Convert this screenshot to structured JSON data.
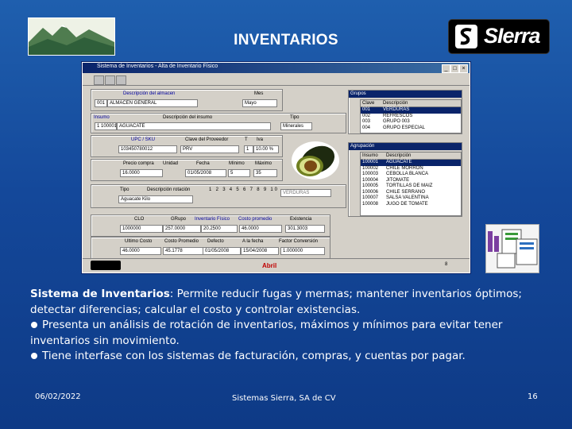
{
  "slide": {
    "title": "INVENTARIOS",
    "logo_text": "SIerra",
    "date": "06/02/2022",
    "company": "Sistemas Sierra, SA de CV",
    "page_number": "16"
  },
  "description": {
    "lead_bold": "Sistema de Inventarios",
    "lead_rest": ":  Permite reducir fugas y mermas; mantener inventarios óptimos; detectar diferencias; calcular el costo y controlar existencias.",
    "bullet1": "Presenta un análisis de rotación de inventarios, máximos y mínimos para evitar tener inventarios sin movimiento.",
    "bullet2": "Tiene interfase con los sistemas de facturación, compras, y cuentas por pagar."
  },
  "window": {
    "title": "Sistema de Inventarios - Alta de Inventario Físico",
    "almacen": {
      "col_desc": "Descripción del almacen",
      "code": "001",
      "value": "ALMACEN GENERAL",
      "mes_label": "Mes",
      "mes_value": "Mayo"
    },
    "insumo": {
      "label": "Insumo",
      "desc_label": "Descripción del insumo",
      "code": "1 100001",
      "value": "AGUACATE",
      "tipo_label": "Tipo",
      "tipo_value": "Minerales"
    },
    "proveedor": {
      "upc_label": "UPC / SKU",
      "clave_label": "Clave del Proveedor",
      "t_label": "T",
      "iva_label": "Iva",
      "upc_value": "103450780012",
      "clave_value": "PRV",
      "t_value": "1",
      "iva_value": "10.00 %"
    },
    "precios": {
      "precio_label": "Precio compra",
      "unidad_label": "Unidad",
      "fecha_label": "Fecha",
      "minimo_label": "Mínimo",
      "maximo_label": "Máximo",
      "precio_value": "16.0000",
      "unidad_value": "KILO",
      "fecha_value": "01/05/2008",
      "minimo_value": "5",
      "maximo_value": "35"
    },
    "rotacion": {
      "tipo_label": "Tipo",
      "desc_label": "Descripción rotación",
      "numbers": "1 2 3 4 5 6 7 8 9 10",
      "tipo_value": "001",
      "desc_value": "VERDURAS",
      "combo_value": "Aguacate Kilo"
    },
    "existencias": {
      "clo_label": "CLO",
      "grupo_label": "GRupo",
      "inv_label": "Inventario Físico",
      "costo_label": "Costo promedio",
      "exist_label": "Existencia",
      "clo_value": "1000000",
      "grupo_value": "257.0000",
      "inv_value": "20.2500",
      "costo_value": "46.0000",
      "exist_value": "301.3003"
    },
    "ultimo": {
      "ult_label": "Ultimo Costo",
      "cprom_label": "Costo Promedio",
      "defecto_label": "Defecto",
      "ala_label": "A la fecha",
      "factor_label": "Factor Conversión",
      "ult_value": "46.0000",
      "cprom_value": "45.1778",
      "defecto_value": "01/05/2008",
      "ala_value": "15/04/2008",
      "factor_value": "1.000000"
    },
    "status": "Abril",
    "status_count": "8",
    "grupos": {
      "title": "Grupos",
      "headers": [
        "Clave",
        "Descripción"
      ],
      "rows": [
        [
          "001",
          "VERDURAS"
        ],
        [
          "002",
          "REFRESCOS"
        ],
        [
          "003",
          "GRUPO 003"
        ],
        [
          "004",
          "GRUPO ESPECIAL"
        ]
      ]
    },
    "agrupacion": {
      "title": "Agrupación",
      "headers": [
        "Insumo",
        "Descripción"
      ],
      "rows": [
        [
          "100001",
          "AGUACATE"
        ],
        [
          "100002",
          "CHILE MORRON"
        ],
        [
          "100003",
          "CEBOLLA BLANCA"
        ],
        [
          "100004",
          "JITOMATE"
        ],
        [
          "100005",
          "TORTILLAS DE MAIZ"
        ],
        [
          "100006",
          "CHILE SERRANO"
        ],
        [
          "100007",
          "SALSA VALENTINA"
        ],
        [
          "100008",
          "JUGO DE TOMATE"
        ]
      ]
    }
  }
}
